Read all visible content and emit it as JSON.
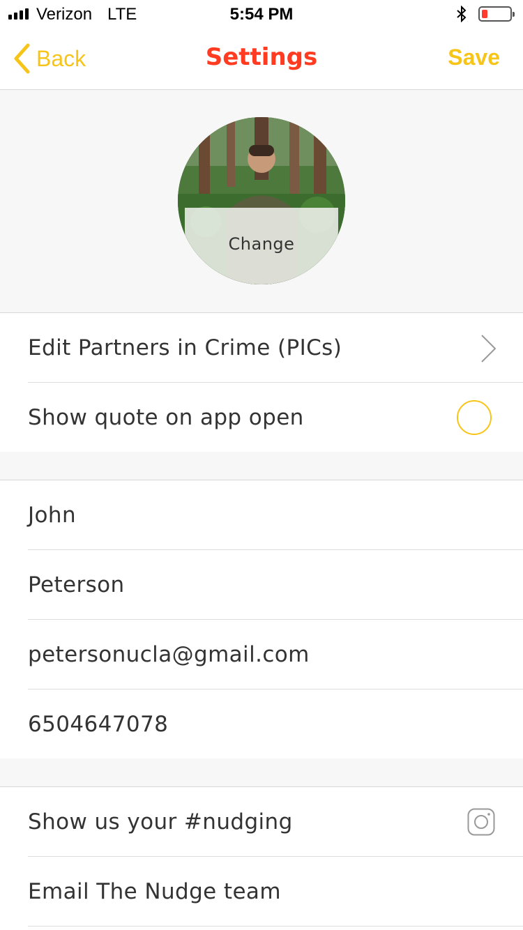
{
  "colors": {
    "accent": "#f7c418",
    "title": "#ff3b22",
    "battery_low": "#ff3b30"
  },
  "status_bar": {
    "carrier": "Verizon",
    "network": "LTE",
    "time": "5:54 PM",
    "battery_level": 0.2
  },
  "nav": {
    "back_label": "Back",
    "title": "Settings",
    "save_label": "Save"
  },
  "avatar": {
    "change_label": "Change"
  },
  "settings": {
    "edit_pics_label": "Edit Partners in Crime (PICs)",
    "show_quote_label": "Show quote on app open",
    "show_quote_enabled": false
  },
  "profile": {
    "first_name": "John",
    "last_name": "Peterson",
    "email": "petersonucla@gmail.com",
    "phone": "6504647078"
  },
  "social": {
    "instagram_label": "Show us your #nudging",
    "email_team_label": "Email The Nudge team"
  }
}
